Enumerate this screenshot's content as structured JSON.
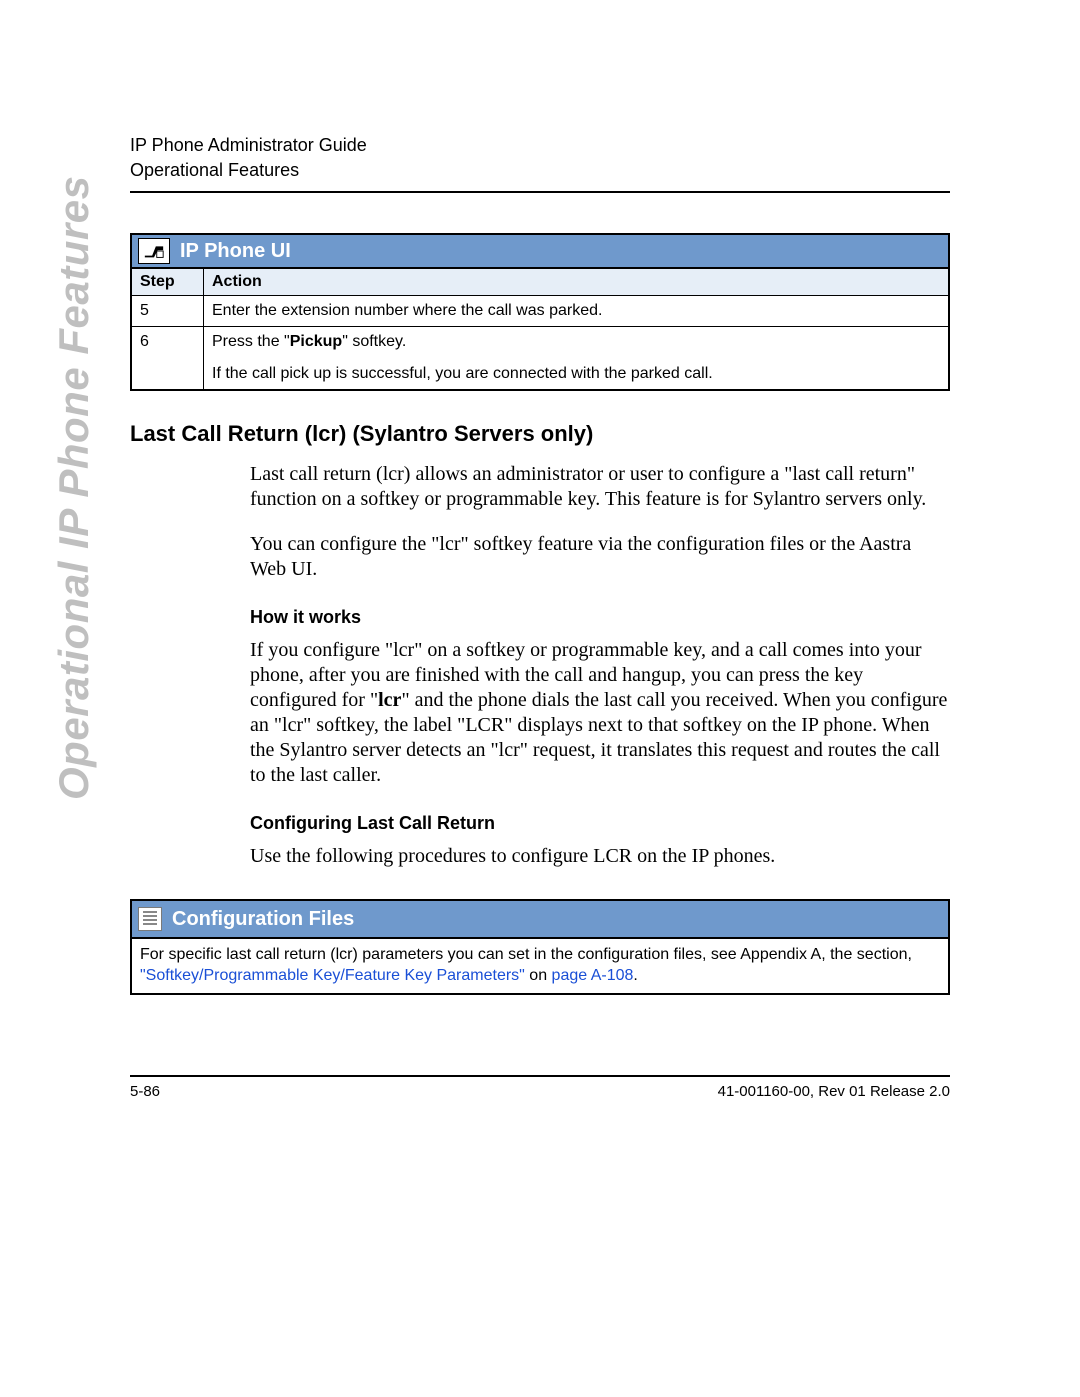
{
  "header": {
    "line1": "IP Phone Administrator Guide",
    "line2": "Operational Features"
  },
  "side_label": "Operational IP Phone Features",
  "ui_box": {
    "title": "IP Phone UI",
    "col_step": "Step",
    "col_action": "Action",
    "rows": [
      {
        "step": "5",
        "action_plain": "Enter the extension number where the call was parked."
      },
      {
        "step": "6",
        "action_pre": "Press the \"",
        "action_bold": "Pickup",
        "action_post": "\" softkey.",
        "extra": "If the call pick up is successful, you are connected with the parked call."
      }
    ]
  },
  "section_title": "Last Call Return (lcr) (Sylantro Servers only)",
  "para1_a": "Last call return (lcr) allows an administrator or user to ",
  "para1_b": "configure a \"last call return\" function on a softkey or programmable key. This feature is for Sylantro servers only.",
  "para2": "You can configure the \"lcr\" softkey feature via the configuration files or the Aastra Web UI.",
  "how_head": "How it works",
  "para3_a": "If you configure \"lcr\" on a softkey or programmable key, and a call comes into your phone, after you are finished with the call and hangup, you can press the key configured for \"",
  "para3_bold": "lcr",
  "para3_b": "\" and the phone dials the last call you received. When you configure an \"lcr\" softkey, the label \"LCR\" displays next to that softkey on the IP phone. When the Sylantro server detects an \"lcr\" request, it translates this request and routes the call to the last caller.",
  "conf_head": "Configuring Last Call Return",
  "para4": "Use the following procedures to configure LCR on the IP phones.",
  "config_box": {
    "title": "Configuration Files",
    "body_a": "For specific last call return (lcr) parameters you can set in the configuration files, see Appendix A, the section, ",
    "link1": "\"Softkey/Programmable Key/Feature Key Parameters\"",
    "body_b": " on ",
    "link2": "page A-108",
    "body_c": "."
  },
  "footer": {
    "left": "5-86",
    "right": "41-001160-00, Rev 01  Release 2.0"
  }
}
